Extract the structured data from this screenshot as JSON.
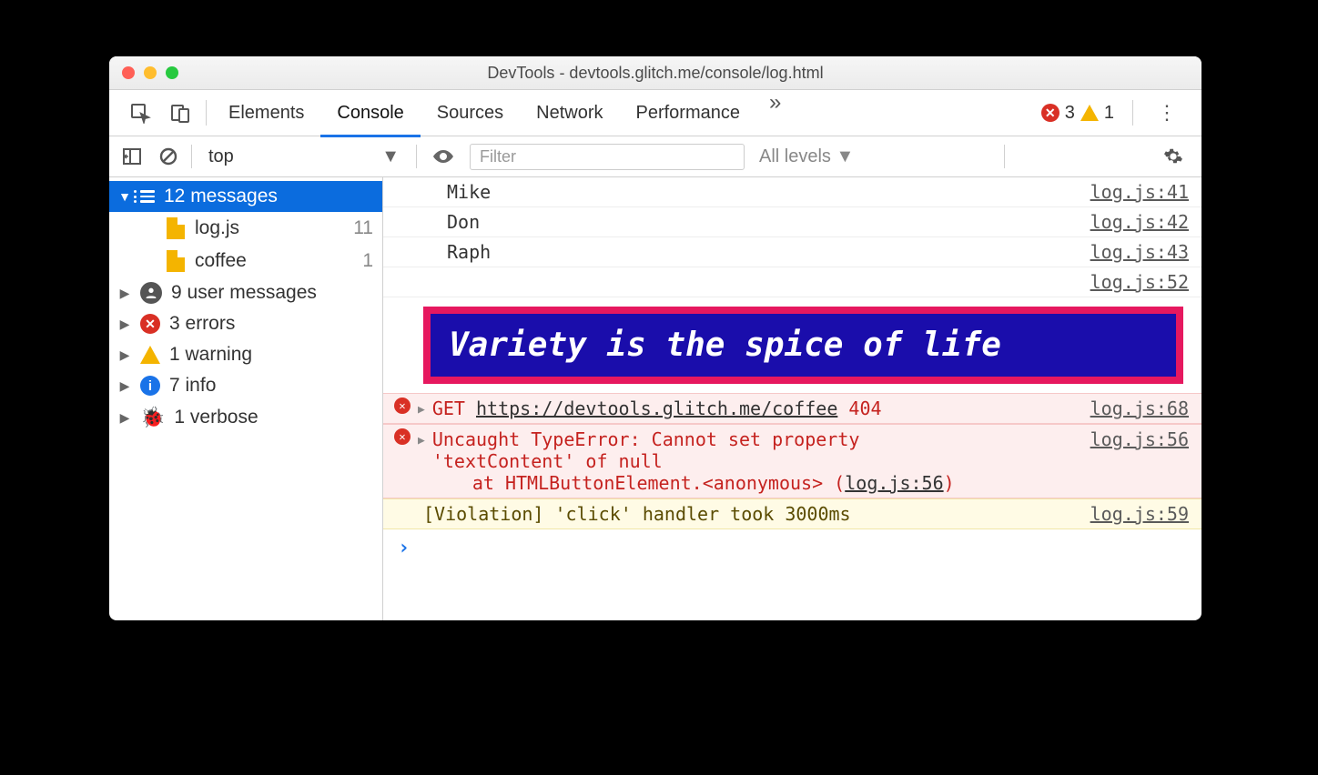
{
  "window_title": "DevTools - devtools.glitch.me/console/log.html",
  "tabs": [
    "Elements",
    "Console",
    "Sources",
    "Network",
    "Performance"
  ],
  "more_tabs": "»",
  "badge_errors": "3",
  "badge_warnings": "1",
  "toolbar": {
    "context": "top",
    "filter_ph": "Filter",
    "levels": "All levels ▼"
  },
  "sidebar": {
    "messages_label": "12 messages",
    "files": [
      {
        "name": "log.js",
        "count": "11"
      },
      {
        "name": "coffee",
        "count": "1"
      }
    ],
    "cats": [
      {
        "label": "9 user messages"
      },
      {
        "label": "3 errors"
      },
      {
        "label": "1 warning"
      },
      {
        "label": "7 info"
      },
      {
        "label": "1 verbose"
      }
    ]
  },
  "log": {
    "names": [
      "Mike",
      "Don",
      "Raph"
    ],
    "name_src": [
      "log.js:41",
      "log.js:42",
      "log.js:43"
    ],
    "blank_src": "log.js:52",
    "styled": "Variety is the spice of life",
    "get": {
      "method": "GET",
      "url": "https://devtools.glitch.me/coffee",
      "code": "404",
      "src": "log.js:68"
    },
    "exc": {
      "l1": "Uncaught TypeError: Cannot set property",
      "l2": "'textContent' of null",
      "l3": "at HTMLButtonElement.<anonymous> (",
      "link": "log.js:56",
      "l3b": ")",
      "src": "log.js:56"
    },
    "viol": {
      "text": "[Violation] 'click' handler took 3000ms",
      "src": "log.js:59"
    }
  }
}
